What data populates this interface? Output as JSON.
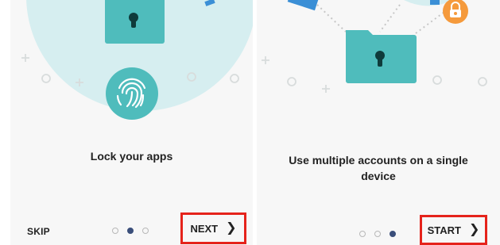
{
  "screens": [
    {
      "title": "Lock your apps",
      "skip_label": "SKIP",
      "primary_label": "NEXT",
      "primary_icon": "chevron-right-icon",
      "pager_total": 3,
      "pager_active_index": 1
    },
    {
      "title": "Use multiple accounts on a single device",
      "primary_label": "START",
      "primary_icon": "chevron-right-icon",
      "pager_total": 3,
      "pager_active_index": 2
    }
  ],
  "colors": {
    "teal": "#4fbcbc",
    "light_teal": "#d6eef0",
    "highlight_border": "#e5231b",
    "lock_orange": "#f59a3c",
    "pager_active": "#3a4e7a"
  }
}
